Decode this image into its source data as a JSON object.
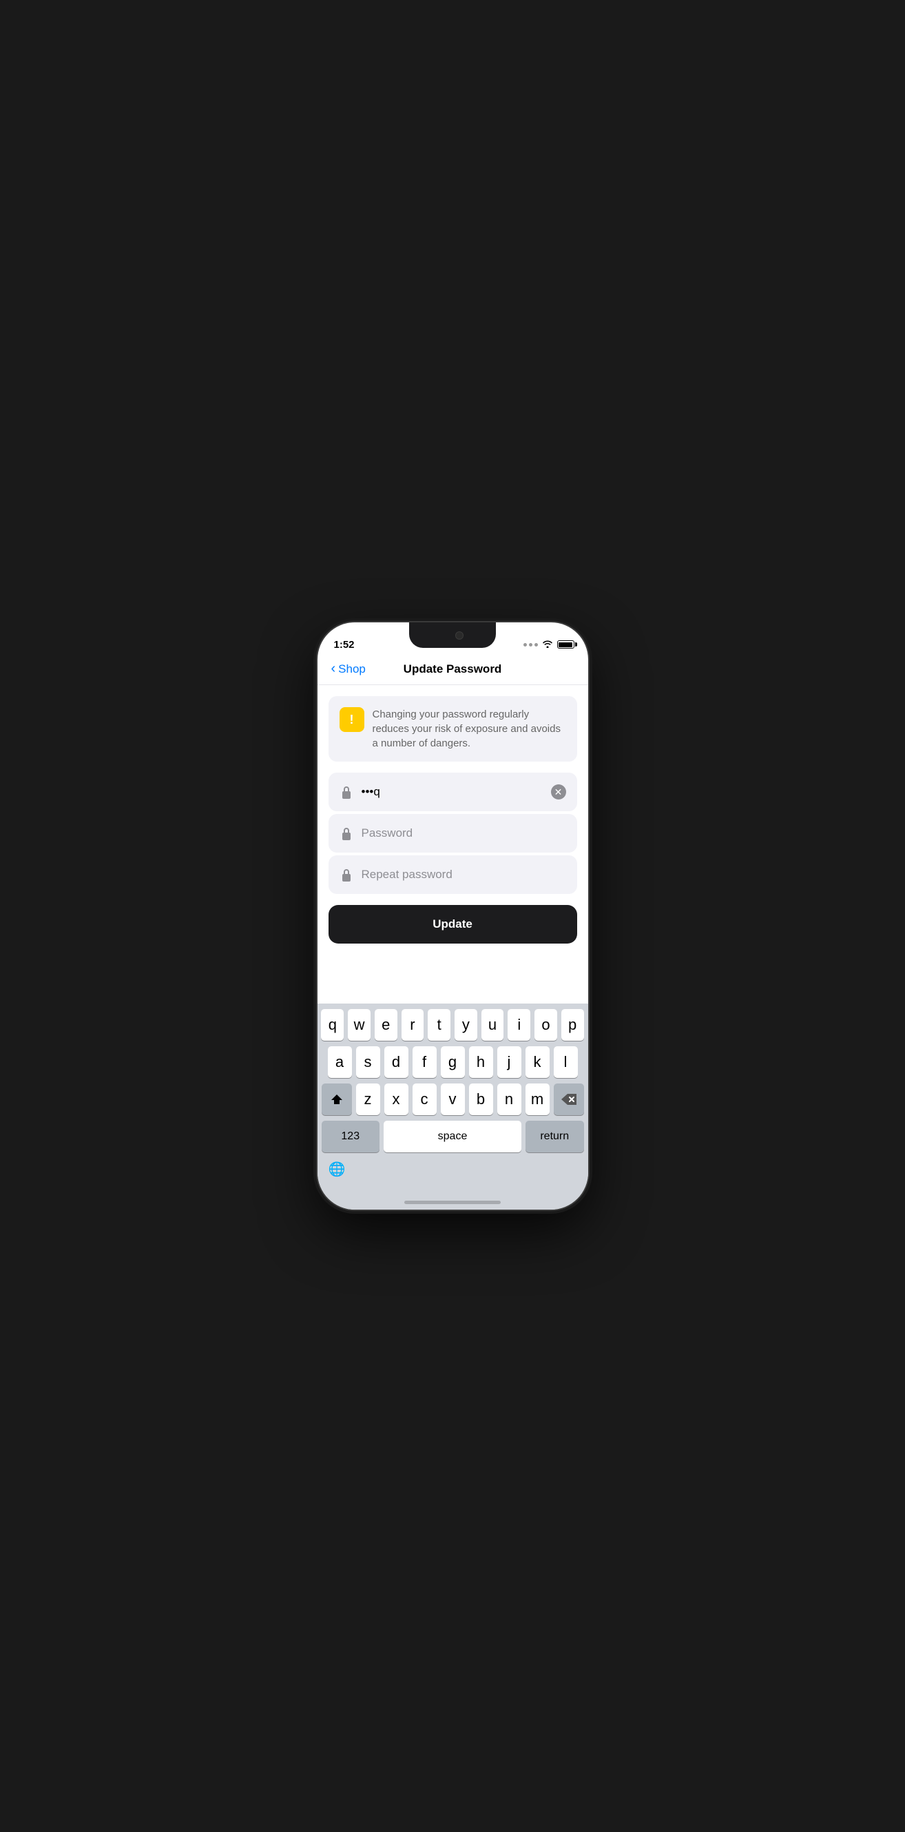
{
  "statusBar": {
    "time": "1:52",
    "batteryLabel": "battery"
  },
  "nav": {
    "backLabel": "Shop",
    "title": "Update Password"
  },
  "infoBanner": {
    "text": "Changing your password regularly reduces your risk of exposure and avoids a number of dangers."
  },
  "fields": {
    "currentPassword": {
      "value": "•••q",
      "placeholder": ""
    },
    "newPassword": {
      "placeholder": "Password"
    },
    "repeatPassword": {
      "placeholder": "Repeat password"
    }
  },
  "updateButton": {
    "label": "Update"
  },
  "keyboard": {
    "row1": [
      "q",
      "w",
      "e",
      "r",
      "t",
      "y",
      "u",
      "i",
      "o",
      "p"
    ],
    "row2": [
      "a",
      "s",
      "d",
      "f",
      "g",
      "h",
      "j",
      "k",
      "l"
    ],
    "row3": [
      "z",
      "x",
      "c",
      "v",
      "b",
      "n",
      "m"
    ],
    "numbersLabel": "123",
    "spaceLabel": "space",
    "returnLabel": "return"
  }
}
